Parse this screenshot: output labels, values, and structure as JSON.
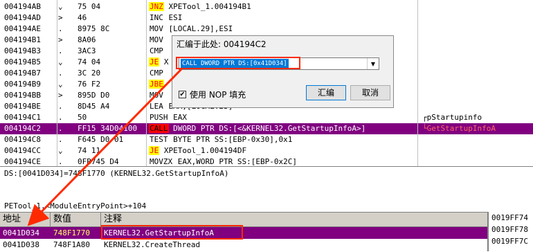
{
  "disasm": {
    "rows": [
      {
        "addr": "004194AB",
        "mark": "⌄",
        "hex": "75 04",
        "mn": "JNZ",
        "mnType": "jcc",
        "ops": "XPETool_1.004194B1",
        "cmt": ""
      },
      {
        "addr": "004194AD",
        "mark": ">",
        "hex": "46",
        "mn": "INC",
        "mnType": "plain",
        "ops": "ESI",
        "cmt": ""
      },
      {
        "addr": "004194AE",
        "mark": ".",
        "hex": "8975 8C",
        "mn": "MOV",
        "mnType": "plain",
        "ops": "[LOCAL.29],ESI",
        "cmt": ""
      },
      {
        "addr": "004194B1",
        "mark": ">",
        "hex": "8A06",
        "mn": "MOV",
        "mnType": "plain",
        "ops": "",
        "cmt": ""
      },
      {
        "addr": "004194B3",
        "mark": ".",
        "hex": "3AC3",
        "mn": "CMP",
        "mnType": "plain",
        "ops": "",
        "cmt": ""
      },
      {
        "addr": "004194B5",
        "mark": "⌄",
        "hex": "74 04",
        "mn": "JE",
        "mnType": "jcc",
        "ops": "X",
        "cmt": ""
      },
      {
        "addr": "004194B7",
        "mark": ".",
        "hex": "3C 20",
        "mn": "CMP",
        "mnType": "plain",
        "ops": "",
        "cmt": ""
      },
      {
        "addr": "004194B9",
        "mark": "⌄",
        "hex": "76 F2",
        "mn": "JBE",
        "mnType": "jcc",
        "ops": "",
        "cmt": ""
      },
      {
        "addr": "004194BB",
        "mark": ">",
        "hex": "895D D0",
        "mn": "MOV",
        "mnType": "plain",
        "ops": "",
        "cmt": ""
      },
      {
        "addr": "004194BE",
        "mark": ".",
        "hex": "8D45 A4",
        "mn": "LEA",
        "mnType": "plain",
        "ops": "EAX,[LOCAL.23]",
        "cmt": ""
      },
      {
        "addr": "004194C1",
        "mark": ".",
        "hex": "50",
        "mn": "PUSH",
        "mnType": "plain",
        "ops": "EAX",
        "cmt": "┌pStartupinfo"
      },
      {
        "addr": "004194C2",
        "mark": ".",
        "hex": "FF15 34D04100",
        "mn": "CALL",
        "mnType": "call",
        "ops": "DWORD PTR DS:[<&KERNEL32.GetStartupInfoA>]",
        "cmt": "└GetStartupInfoA",
        "selected": true
      },
      {
        "addr": "004194C8",
        "mark": ".",
        "hex": "F645 D0 01",
        "mn": "TEST",
        "mnType": "plain",
        "ops": "BYTE PTR SS:[EBP-0x30],0x1",
        "cmt": ""
      },
      {
        "addr": "004194CC",
        "mark": "⌄",
        "hex": "74 11",
        "mn": "JE",
        "mnType": "jcc",
        "ops": "XPETool_1.004194DF",
        "cmt": ""
      },
      {
        "addr": "004194CE",
        "mark": ".",
        "hex": "0FB745 D4",
        "mn": "MOVZX",
        "mnType": "plain",
        "ops": "EAX,WORD PTR SS:[EBP-0x2C]",
        "cmt": ""
      }
    ]
  },
  "info": {
    "line1": "DS:[0041D034]=748F1770 (KERNEL32.GetStartupInfoA)",
    "line2": "PETool_1.<ModuleEntryPoint>+104"
  },
  "dump": {
    "headers": {
      "addr": "地址",
      "value": "数值",
      "comment": "注释"
    },
    "rows": [
      {
        "addr": "0041D034",
        "value": "748F1770",
        "comment": "KERNEL32.GetStartupInfoA",
        "selected": true
      },
      {
        "addr": "0041D038",
        "value": "748F1A80",
        "comment": "KERNEL32.CreateThread"
      }
    ]
  },
  "stack": {
    "lines": [
      "0019FF74",
      "0019FF78",
      "0019FF7C"
    ]
  },
  "dialog": {
    "title": "汇编于此处: 004194C2",
    "input_value": "CALL DWORD PTR DS:[0x41D034]",
    "checkbox_label": "使用 NOP 填充",
    "checkbox_checked": "✔",
    "assemble_button": "汇编",
    "cancel_button": "取消",
    "dropdown_glyph": "▼"
  },
  "colors": {
    "selection": "#800080",
    "jump_highlight": "#ffff00",
    "call_highlight": "#ff0000",
    "annotation": "#ff2a00"
  }
}
